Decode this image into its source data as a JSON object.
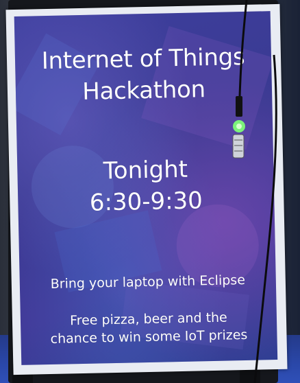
{
  "poster": {
    "title_line1": "Internet of Things",
    "title_line2": "Hackathon",
    "when_line1": "Tonight",
    "when_line2": "6:30-9:30",
    "note_line1": "Bring your laptop with Eclipse",
    "note_line2": "Free pizza, beer and the",
    "note_line3": "chance to win some IoT prizes"
  },
  "colors": {
    "poster_background": "#3e3f9e",
    "poster_text": "#ffffff",
    "poster_border": "#e9ecf3",
    "stand": "#15171c",
    "floor": "#2a47a8",
    "led": "#7cf27a"
  },
  "objects": [
    "sign-stand",
    "poster",
    "hanging-cable",
    "led-device"
  ]
}
